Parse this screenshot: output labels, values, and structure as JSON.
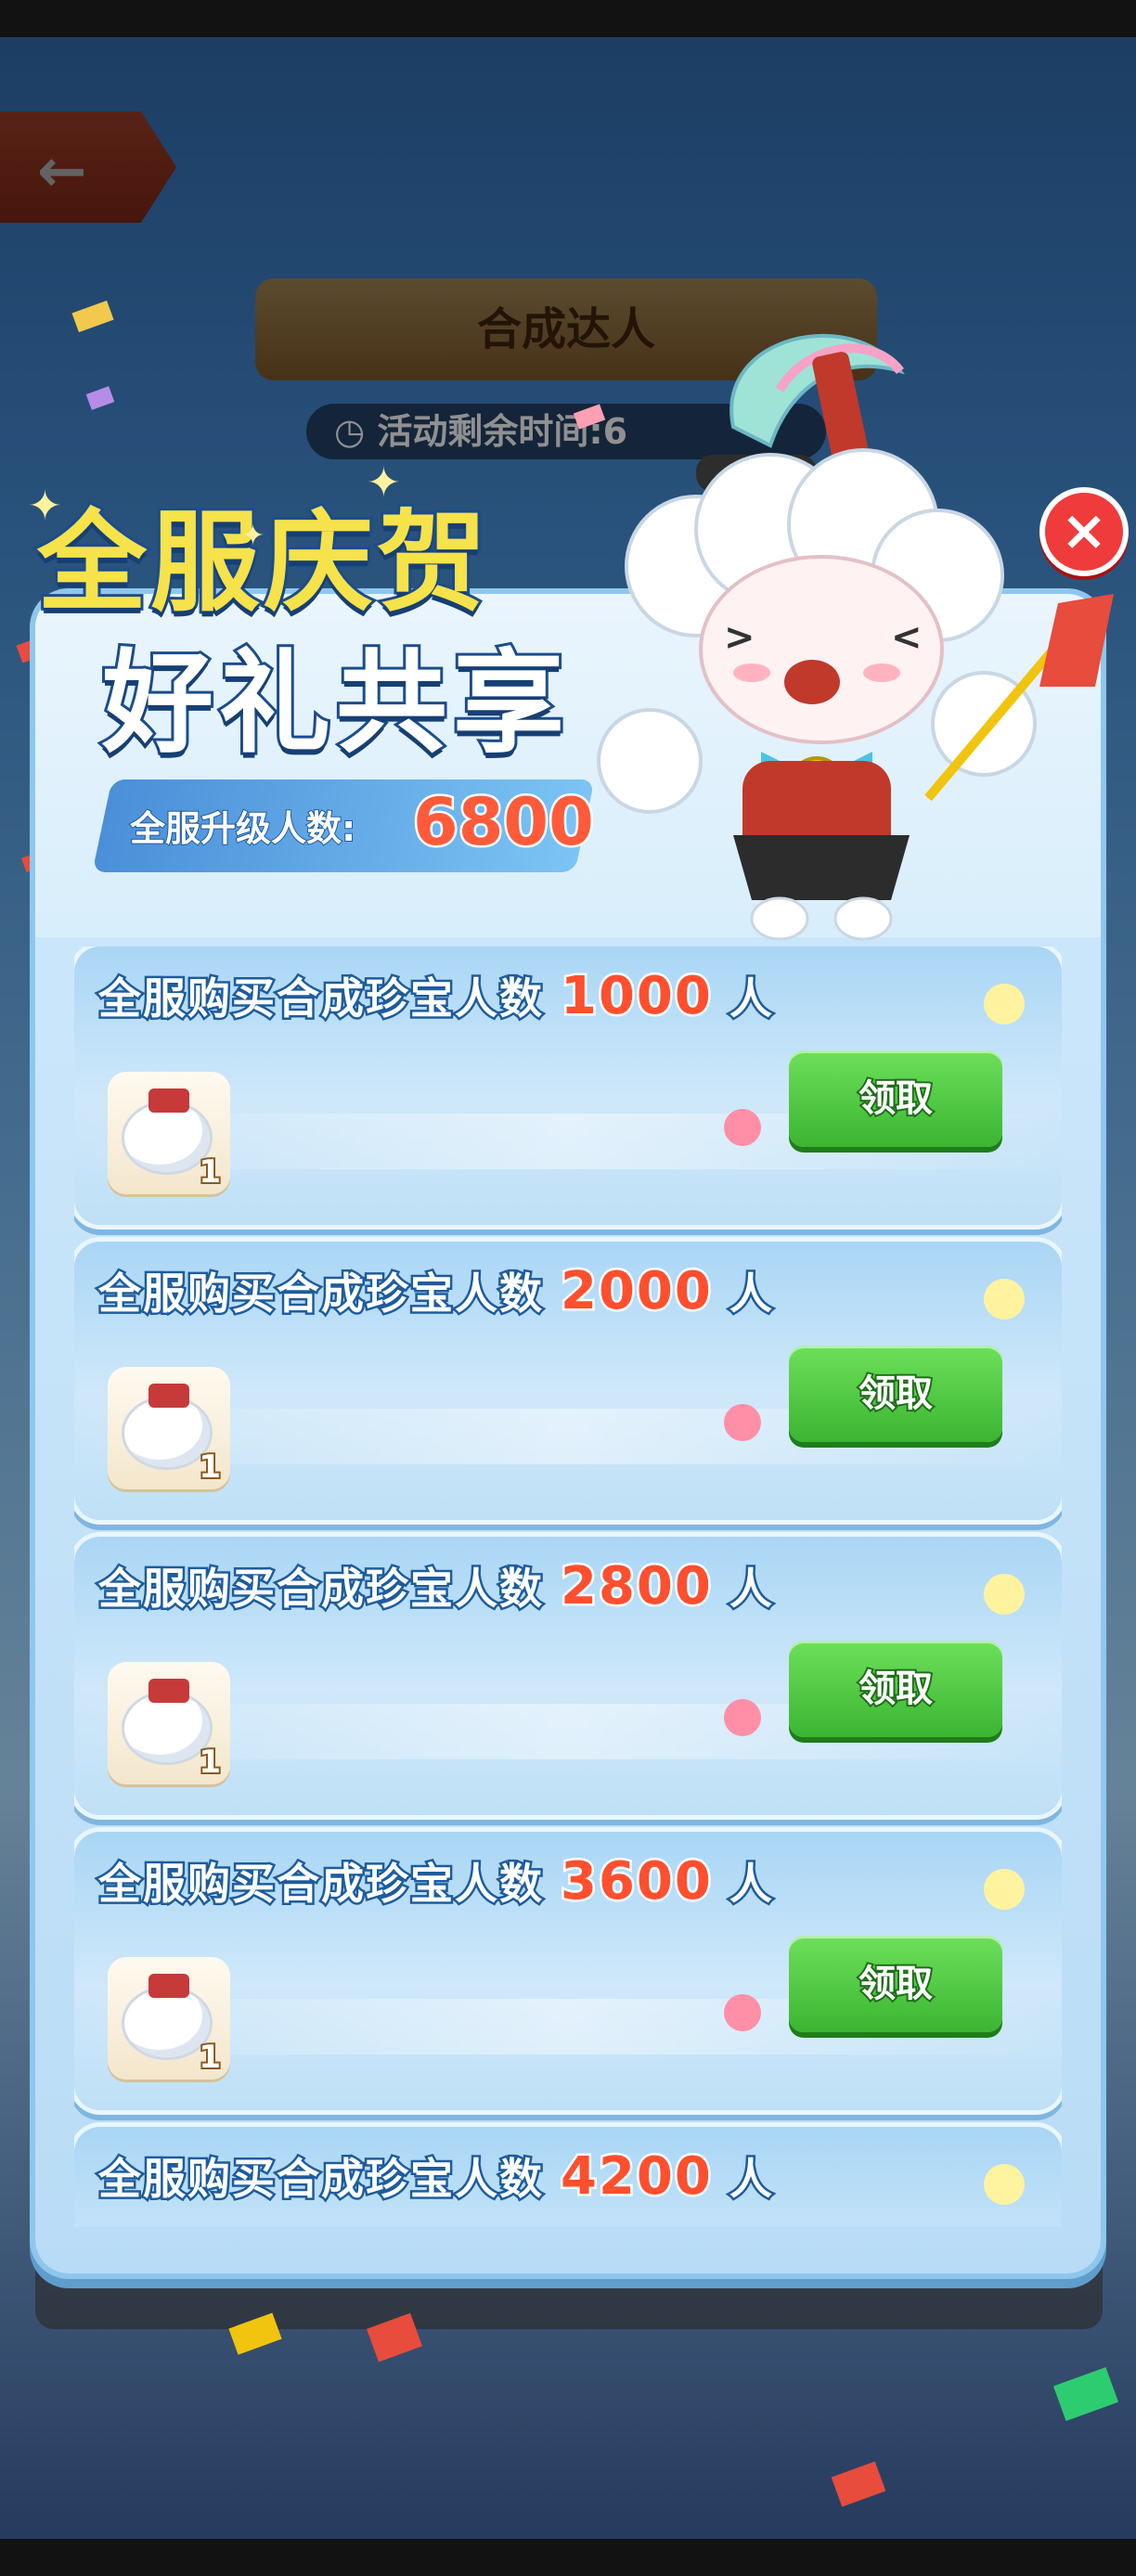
{
  "background": {
    "back_icon": "←",
    "title": "合成达人",
    "timer_icon": "clock-icon",
    "timer_text": "活动剩余时间:6"
  },
  "dialog": {
    "banner_line1": "全服庆贺",
    "banner_line2": "好礼共享",
    "count_label": "全服升级人数:",
    "count_value": "6800",
    "close_icon": "×"
  },
  "tasks": [
    {
      "prefix": "全服购买合成珍宝人数",
      "target": "1000",
      "suffix": "人",
      "reward_qty": "1",
      "button": "领取"
    },
    {
      "prefix": "全服购买合成珍宝人数",
      "target": "2000",
      "suffix": "人",
      "reward_qty": "1",
      "button": "领取"
    },
    {
      "prefix": "全服购买合成珍宝人数",
      "target": "2800",
      "suffix": "人",
      "reward_qty": "1",
      "button": "领取"
    },
    {
      "prefix": "全服购买合成珍宝人数",
      "target": "3600",
      "suffix": "人",
      "reward_qty": "1",
      "button": "领取"
    },
    {
      "prefix": "全服购买合成珍宝人数",
      "target": "4200",
      "suffix": "人"
    }
  ],
  "colors": {
    "accent_number": "#ff4f2e",
    "claim_button": "#3bb532",
    "close_button": "#ef3b3b"
  }
}
